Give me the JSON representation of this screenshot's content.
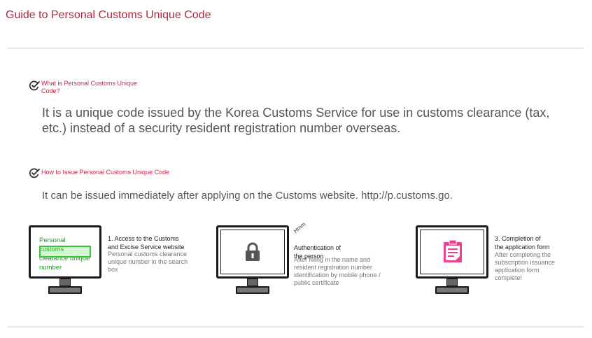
{
  "page": {
    "title": "Guide to Personal Customs Unique Code"
  },
  "sections": [
    {
      "heading": "What is Personal Customs Unique Code?",
      "icon": "check-circle-icon",
      "body": "It is a unique code issued by the Korea Customs Service for use in customs clearance (tax, etc.) instead of a security resident registration number overseas."
    },
    {
      "heading": "How to Issue Personal Customs Unique Code",
      "icon": "check-circle-icon",
      "body": "It can be issued immediately after applying on the Customs website. http://p.customs.go."
    }
  ],
  "steps": [
    {
      "screen_text": "Personal customs clearance unique number",
      "title": "1. Access to the Customs and Excise Service website",
      "desc": "Personal customs clearance unique number in the search box",
      "icon": "monitor-icon"
    },
    {
      "note": "Hmm",
      "title": "Authentication of the person",
      "desc": "After filling in the name and resident registration number identification by mobile phone / public certificate",
      "icon": "lock-icon"
    },
    {
      "title": "3. Completion of the application form",
      "desc": "After completing the subscription issuance application form complete!",
      "icon": "clipboard-icon"
    }
  ],
  "colors": {
    "accent": "#b0283e",
    "highlight_green": "#3ac23a",
    "form_pink": "#e9428f",
    "lock_gray": "#555555"
  }
}
